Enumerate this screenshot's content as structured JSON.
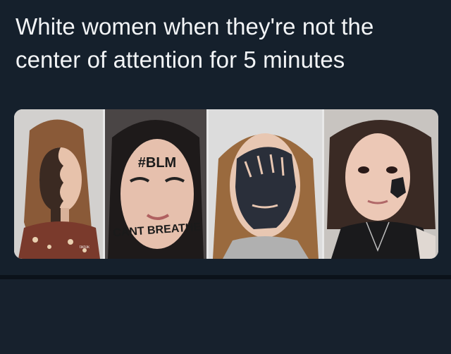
{
  "post": {
    "caption_line1": "White women when they're not the",
    "caption_line2": "center of attention for 5 minutes",
    "watermark": "tiktok"
  },
  "photos": {
    "panel2_forehead_text": "#BLM",
    "panel2_mouth_text": "CANT BREATHE"
  },
  "colors": {
    "background": "#15202c",
    "caption_text": "#f2f4f6",
    "divider": "#0b121a"
  }
}
